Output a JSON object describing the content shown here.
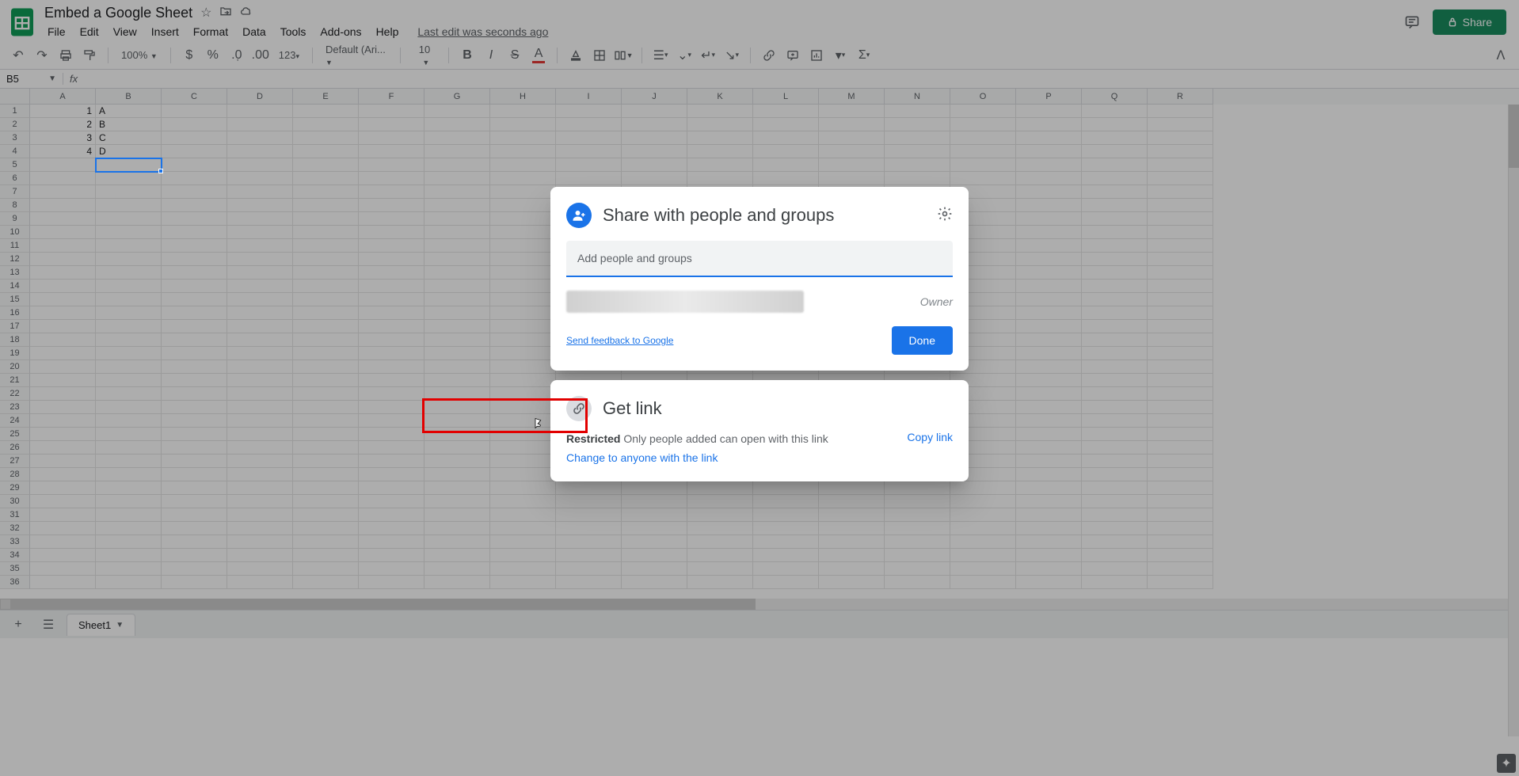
{
  "header": {
    "doc_title": "Embed a Google Sheet",
    "menus": [
      "File",
      "Edit",
      "View",
      "Insert",
      "Format",
      "Data",
      "Tools",
      "Add-ons",
      "Help"
    ],
    "last_edit": "Last edit was seconds ago",
    "share_label": "Share"
  },
  "toolbar": {
    "zoom": "100%",
    "font": "Default (Ari...",
    "size": "10",
    "number_fmt": "123"
  },
  "formula": {
    "cell": "B5",
    "value": ""
  },
  "grid": {
    "cols": [
      "A",
      "B",
      "C",
      "D",
      "E",
      "F",
      "G",
      "H",
      "I",
      "J",
      "K",
      "L",
      "M",
      "N",
      "O",
      "P",
      "Q",
      "R"
    ],
    "row_count": 36,
    "dataA": [
      "1",
      "2",
      "3",
      "4"
    ],
    "dataB": [
      "A",
      "B",
      "C",
      "D"
    ],
    "selected": "B5"
  },
  "sheet_tab": "Sheet1",
  "share_modal": {
    "title": "Share with people and groups",
    "placeholder": "Add people and groups",
    "owner": "Owner",
    "feedback": "Send feedback to Google",
    "done": "Done"
  },
  "link_modal": {
    "title": "Get link",
    "restricted": "Restricted",
    "desc": "Only people added can open with this link",
    "change": "Change to anyone with the link",
    "copy": "Copy link"
  }
}
